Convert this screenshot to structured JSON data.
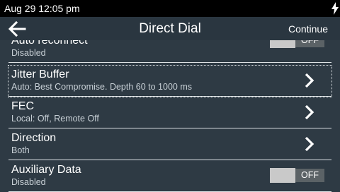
{
  "status": {
    "datetime": "Aug 29 12:05 pm",
    "charging_icon": "bolt-icon"
  },
  "appbar": {
    "back_icon": "arrow-left-icon",
    "title": "Direct Dial",
    "action_label": "Continue"
  },
  "settings": [
    {
      "title": "Auto reconnect",
      "subtitle": "Disabled",
      "control": "toggle",
      "toggle_label": "OFF",
      "on": false
    },
    {
      "title": "Jitter Buffer",
      "subtitle": "Auto: Best Compromise.  Depth 60 to 1000 ms",
      "control": "chevron",
      "focused": true
    },
    {
      "title": "FEC",
      "subtitle": "Local: Off, Remote Off",
      "control": "chevron"
    },
    {
      "title": "Direction",
      "subtitle": "Both",
      "control": "chevron"
    },
    {
      "title": "Auxiliary Data",
      "subtitle": "Disabled",
      "control": "toggle",
      "toggle_label": "OFF",
      "on": false
    }
  ],
  "colors": {
    "background": "#2e3a44",
    "statusbar": "#000000",
    "divider": "#dfe3e6",
    "toggle_thumb": "#c9c9c9",
    "toggle_track": "#5b6266"
  }
}
